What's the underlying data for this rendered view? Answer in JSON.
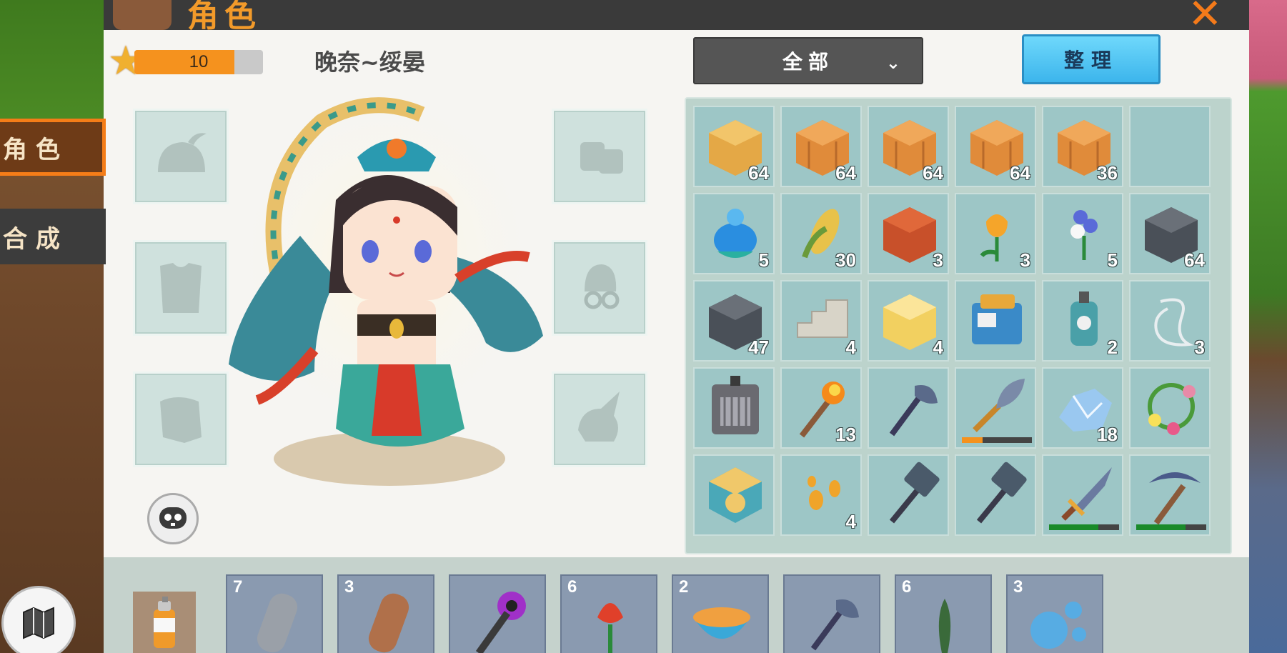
{
  "header": {
    "title": "角色",
    "close_icon": "close-x-icon"
  },
  "side_tabs": [
    {
      "label": "角色",
      "active": true
    },
    {
      "label": "合成",
      "active": false
    }
  ],
  "player": {
    "level": "10",
    "level_progress": 0.78,
    "name": "晚奈~绥晏"
  },
  "filter": {
    "selected": "全部",
    "chevron_icon": "chevron-down-icon"
  },
  "sort_button": {
    "label": "整理"
  },
  "equipment_slots": [
    {
      "name": "helmet-slot",
      "icon": "helmet-icon"
    },
    {
      "name": "chest-slot",
      "icon": "chestplate-icon"
    },
    {
      "name": "legs-slot",
      "icon": "leggings-icon"
    },
    {
      "name": "boots-slot",
      "icon": "boots-icon"
    },
    {
      "name": "accessory-slot",
      "icon": "glasses-icon"
    },
    {
      "name": "mount-slot",
      "icon": "mount-icon"
    }
  ],
  "inventory": [
    {
      "icon": "sand-block-icon",
      "qty": "64",
      "color": "#e4a846"
    },
    {
      "icon": "wood-plank-icon",
      "qty": "64",
      "color": "#e08b3a"
    },
    {
      "icon": "wood-plank-icon",
      "qty": "64",
      "color": "#e08b3a"
    },
    {
      "icon": "wood-plank-icon",
      "qty": "64",
      "color": "#e08b3a"
    },
    {
      "icon": "wood-plank-icon",
      "qty": "36",
      "color": "#e08b3a"
    },
    {
      "icon": "",
      "qty": "",
      "color": ""
    },
    {
      "icon": "blue-flower-pot-icon",
      "qty": "5",
      "color": "#2a8ee0"
    },
    {
      "icon": "corn-icon",
      "qty": "30",
      "color": "#e8c24a"
    },
    {
      "icon": "red-brick-icon",
      "qty": "3",
      "color": "#c8502a"
    },
    {
      "icon": "tulip-icon",
      "qty": "3",
      "color": "#f5a52a"
    },
    {
      "icon": "blue-flower-icon",
      "qty": "5",
      "color": "#5a6ad8"
    },
    {
      "icon": "stone-block-icon",
      "qty": "64",
      "color": "#4a5058"
    },
    {
      "icon": "stone-block-icon",
      "qty": "47",
      "color": "#4a5058"
    },
    {
      "icon": "stone-stairs-icon",
      "qty": "4",
      "color": "#d8d4c8"
    },
    {
      "icon": "gold-block-icon",
      "qty": "4",
      "color": "#f2d060"
    },
    {
      "icon": "machine-icon",
      "qty": "",
      "color": "#3a8ac8"
    },
    {
      "icon": "lantern-icon",
      "qty": "2",
      "color": "#4aa0a8"
    },
    {
      "icon": "string-icon",
      "qty": "3",
      "color": "#e8eef0"
    },
    {
      "icon": "furnace-icon",
      "qty": "",
      "color": "#6a6a70"
    },
    {
      "icon": "torch-icon",
      "qty": "13",
      "color": "#f58a1a"
    },
    {
      "icon": "axe-icon",
      "qty": "",
      "color": "#5a6a8a"
    },
    {
      "icon": "shovel-icon",
      "qty": "",
      "color": "#7a8aa8",
      "durability": 0.3,
      "durability_color": "#f5921e"
    },
    {
      "icon": "ice-crystal-icon",
      "qty": "18",
      "color": "#9ac8f0"
    },
    {
      "icon": "flower-wreath-icon",
      "qty": "",
      "color": "#e88aa8"
    },
    {
      "icon": "storage-cube-icon",
      "qty": "",
      "color": "#4aa8b8"
    },
    {
      "icon": "seeds-icon",
      "qty": "4",
      "color": "#f0a42a"
    },
    {
      "icon": "hammer-icon",
      "qty": "",
      "color": "#4a5a6a"
    },
    {
      "icon": "hammer-icon",
      "qty": "",
      "color": "#4a5a6a"
    },
    {
      "icon": "sword-icon",
      "qty": "",
      "color": "#6a7aa0",
      "durability": 0.7,
      "durability_color": "#1a8a2a"
    },
    {
      "icon": "pickaxe-icon",
      "qty": "",
      "color": "#4a5a8a",
      "durability": 0.7,
      "durability_color": "#1a8a2a"
    }
  ],
  "hotbar": [
    {
      "icon": "iron-ingot-icon",
      "qty": "7",
      "color": "#9aa0a8"
    },
    {
      "icon": "copper-ingot-icon",
      "qty": "3",
      "color": "#b0704a"
    },
    {
      "icon": "saw-tool-icon",
      "qty": "",
      "color": "#a030c8"
    },
    {
      "icon": "red-flower-icon",
      "qty": "6",
      "color": "#e0402a"
    },
    {
      "icon": "noodle-bowl-icon",
      "qty": "2",
      "color": "#f0a040"
    },
    {
      "icon": "axe-icon",
      "qty": "",
      "color": "#5a6a8a"
    },
    {
      "icon": "sapling-icon",
      "qty": "6",
      "color": "#3a6a3a"
    },
    {
      "icon": "bubbles-icon",
      "qty": "3",
      "color": "#4ab0f0"
    }
  ],
  "spray_can_icon": "spray-can-icon",
  "chat_icon": "chat-bot-icon",
  "map_icon": "map-icon",
  "colors": {
    "accent_orange": "#f57d18",
    "panel_bg": "#f6f5f2",
    "slot_bg": "#9dc6c6",
    "sort_blue": "#3cb5ec"
  }
}
